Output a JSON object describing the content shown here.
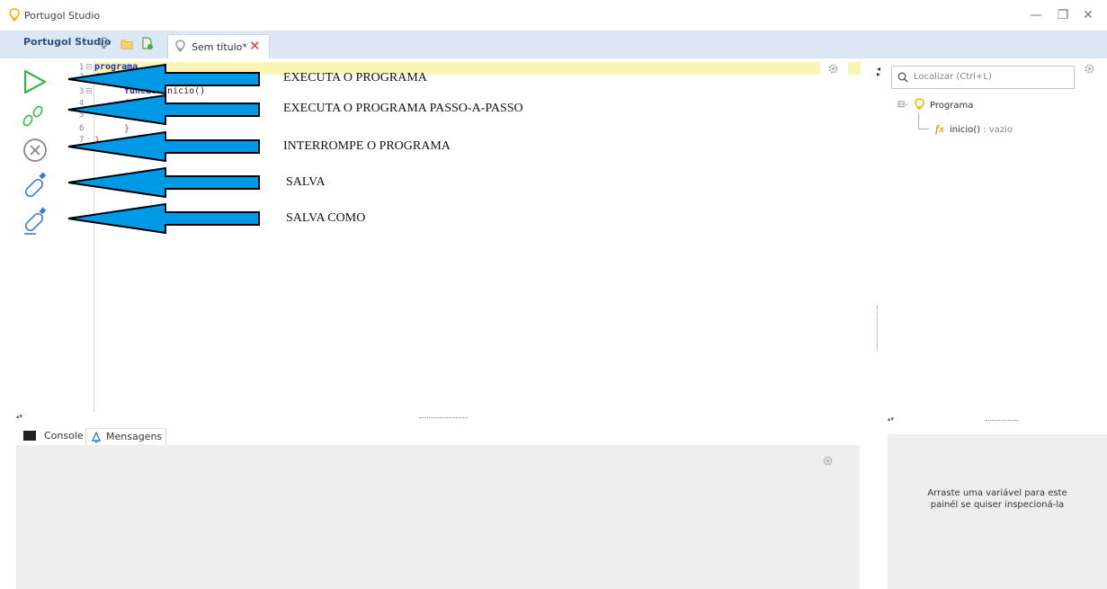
{
  "window": {
    "title": "Portugol Studio",
    "controls": [
      "—",
      "❐",
      "✕"
    ]
  },
  "tabs": {
    "home_label": "Portugol Studio",
    "doc_label": "Sem título*",
    "doc_close": "✕"
  },
  "editor": {
    "line_numbers": [
      "1",
      "2",
      "3",
      "4",
      "5",
      "6",
      "7"
    ],
    "code": {
      "line1": "programa",
      "line2": "{",
      "line3_kw": "funcao",
      "line3_name": " inicio()",
      "line4": "{",
      "line6": "}",
      "line7": "}"
    }
  },
  "annotations": {
    "run": "EXECUTA O PROGRAMA",
    "step": "EXECUTA O PROGRAMA PASSO-A-PASSO",
    "stop": "INTERROMPE O PROGRAMA",
    "save": "SALVA",
    "save_as": "SALVA COMO"
  },
  "outline": {
    "search_placeholder": "Localizar (Ctrl+L)",
    "root_label": "Programa",
    "func_label": "inicio()",
    "func_type": " : vazio"
  },
  "bottom": {
    "console_tab": "Console",
    "messages_tab": "Mensagens",
    "inspect_line1": "Arraste uma variável para este",
    "inspect_line2": "painél se quiser inspecioná-la"
  },
  "colors": {
    "accent_blue": "#0099e6",
    "run_green": "#3ab54a",
    "tabstrip": "#dce7f5",
    "close_red": "#e0394a"
  }
}
